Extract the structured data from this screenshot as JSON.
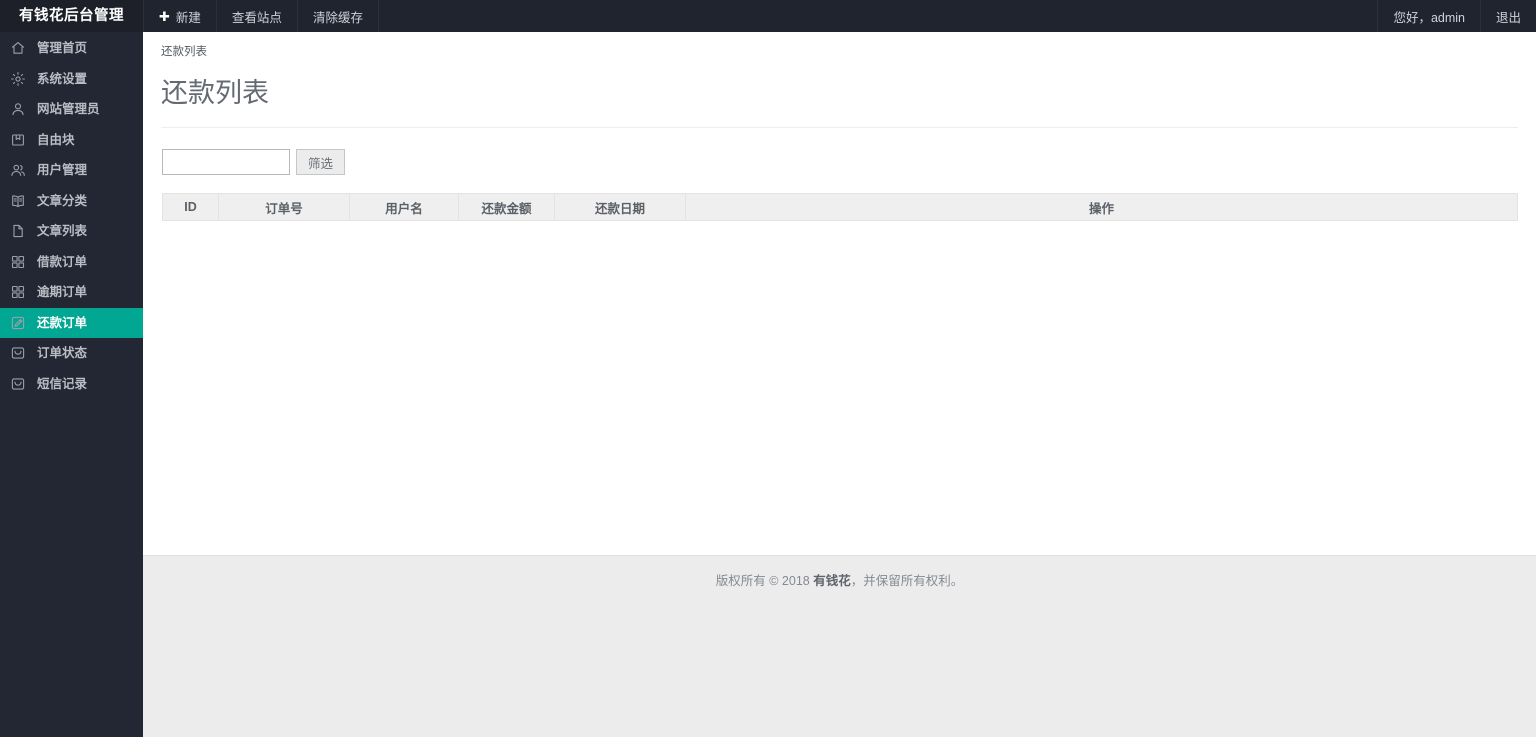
{
  "brand": {
    "title": "有钱花后台管理"
  },
  "topbar": {
    "items": [
      {
        "label": "新建",
        "icon": "plus-icon",
        "has_plus": true
      },
      {
        "label": "查看站点",
        "icon": null,
        "has_plus": false
      },
      {
        "label": "清除缓存",
        "icon": null,
        "has_plus": false
      }
    ],
    "greeting": "您好，admin",
    "logout_label": "退出"
  },
  "sidebar": {
    "items": [
      {
        "label": "管理首页",
        "icon": "home-icon",
        "active": false
      },
      {
        "label": "系统设置",
        "icon": "gear-icon",
        "active": false
      },
      {
        "label": "网站管理员",
        "icon": "user-icon",
        "active": false
      },
      {
        "label": "自由块",
        "icon": "book-icon",
        "active": false
      },
      {
        "label": "用户管理",
        "icon": "users-icon",
        "active": false
      },
      {
        "label": "文章分类",
        "icon": "book-open-icon",
        "active": false
      },
      {
        "label": "文章列表",
        "icon": "file-icon",
        "active": false
      },
      {
        "label": "借款订单",
        "icon": "grid-icon",
        "active": false
      },
      {
        "label": "逾期订单",
        "icon": "grid-icon",
        "active": false
      },
      {
        "label": "还款订单",
        "icon": "edit-square-icon",
        "active": true
      },
      {
        "label": "订单状态",
        "icon": "inbox-icon",
        "active": false
      },
      {
        "label": "短信记录",
        "icon": "inbox-icon",
        "active": false
      }
    ]
  },
  "main": {
    "breadcrumb": "还款列表",
    "page_title": "还款列表",
    "filter": {
      "input_value": "",
      "input_placeholder": "",
      "button_label": "筛选"
    },
    "table": {
      "columns": [
        "ID",
        "订单号",
        "用户名",
        "还款金额",
        "还款日期",
        "操作"
      ],
      "rows": []
    }
  },
  "footer": {
    "prefix": "版权所有 © 2018 ",
    "brand": "有钱花",
    "suffix": "，并保留所有权利。"
  },
  "colors": {
    "sidebar_bg": "#232733",
    "brand_bg": "#1d2028",
    "topbar_bg": "#20242f",
    "accent_teal": "#02a793",
    "content_bg": "#ffffff",
    "footer_bg": "#ececec"
  }
}
